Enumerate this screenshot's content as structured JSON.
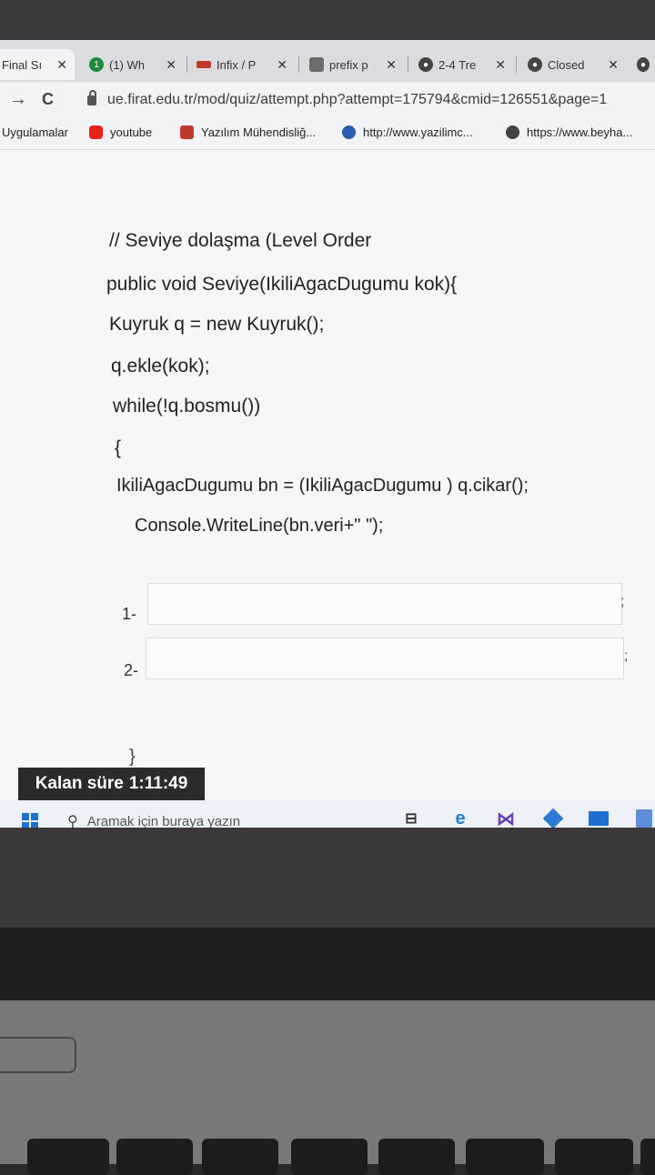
{
  "browser": {
    "tabs": [
      {
        "title": "Final Sı",
        "icon_color": "#0f3a6e"
      },
      {
        "title": "(1) Wh",
        "icon_color": "#1f8a3a"
      },
      {
        "title": "Infix / P",
        "icon_color": "#c0392b"
      },
      {
        "title": "prefix p",
        "icon_color": "#6b6b6b"
      },
      {
        "title": "2-4 Tre",
        "icon_color": "#444444"
      },
      {
        "title": "Closed",
        "icon_color": "#444444"
      }
    ],
    "close_glyph": "✕",
    "nav": {
      "forward": "→",
      "reload": "C"
    },
    "url": "ue.firat.edu.tr/mod/quiz/attempt.php?attempt=175794&cmid=126551&page=1",
    "bookmarks": [
      {
        "label": "Uygulamalar",
        "icon_color": ""
      },
      {
        "label": "youtube",
        "icon_color": "#e62117"
      },
      {
        "label": "Yazılım Mühendisliğ...",
        "icon_color": "#c0392b"
      },
      {
        "label": "http://www.yazilimc...",
        "icon_color": "#2a5db0"
      },
      {
        "label": "https://www.beyha...",
        "icon_color": "#444444"
      }
    ]
  },
  "quiz": {
    "code_lines": [
      "// Seviye dolaşma (Level Order",
      "public void Seviye(IkiliAgacDugumu kok){",
      "Kuyruk q = new Kuyruk();",
      "q.ekle(kok);",
      "while(!q.bosmu())",
      "{",
      "IkiliAgacDugumu  bn = (IkiliAgacDugumu ) q.cikar();",
      "Console.WriteLine(bn.veri+\" \");"
    ],
    "answers": [
      {
        "label": "1-",
        "value": "",
        "suffix": ";"
      },
      {
        "label": "2-",
        "value": "",
        "suffix": ";"
      }
    ],
    "closing_braces": [
      "}",
      "}"
    ]
  },
  "timer": {
    "label": "Kalan süre",
    "value": "1:11:49"
  },
  "taskbar": {
    "search_placeholder": "Aramak için buraya yazın",
    "apps": [
      "task-view",
      "edge",
      "visual-studio",
      "box-app",
      "mail",
      "file-app"
    ]
  },
  "colors": {
    "accent": "#1e6fd0",
    "edge": "#1e7fd6",
    "vs": "#6a3fb5"
  }
}
